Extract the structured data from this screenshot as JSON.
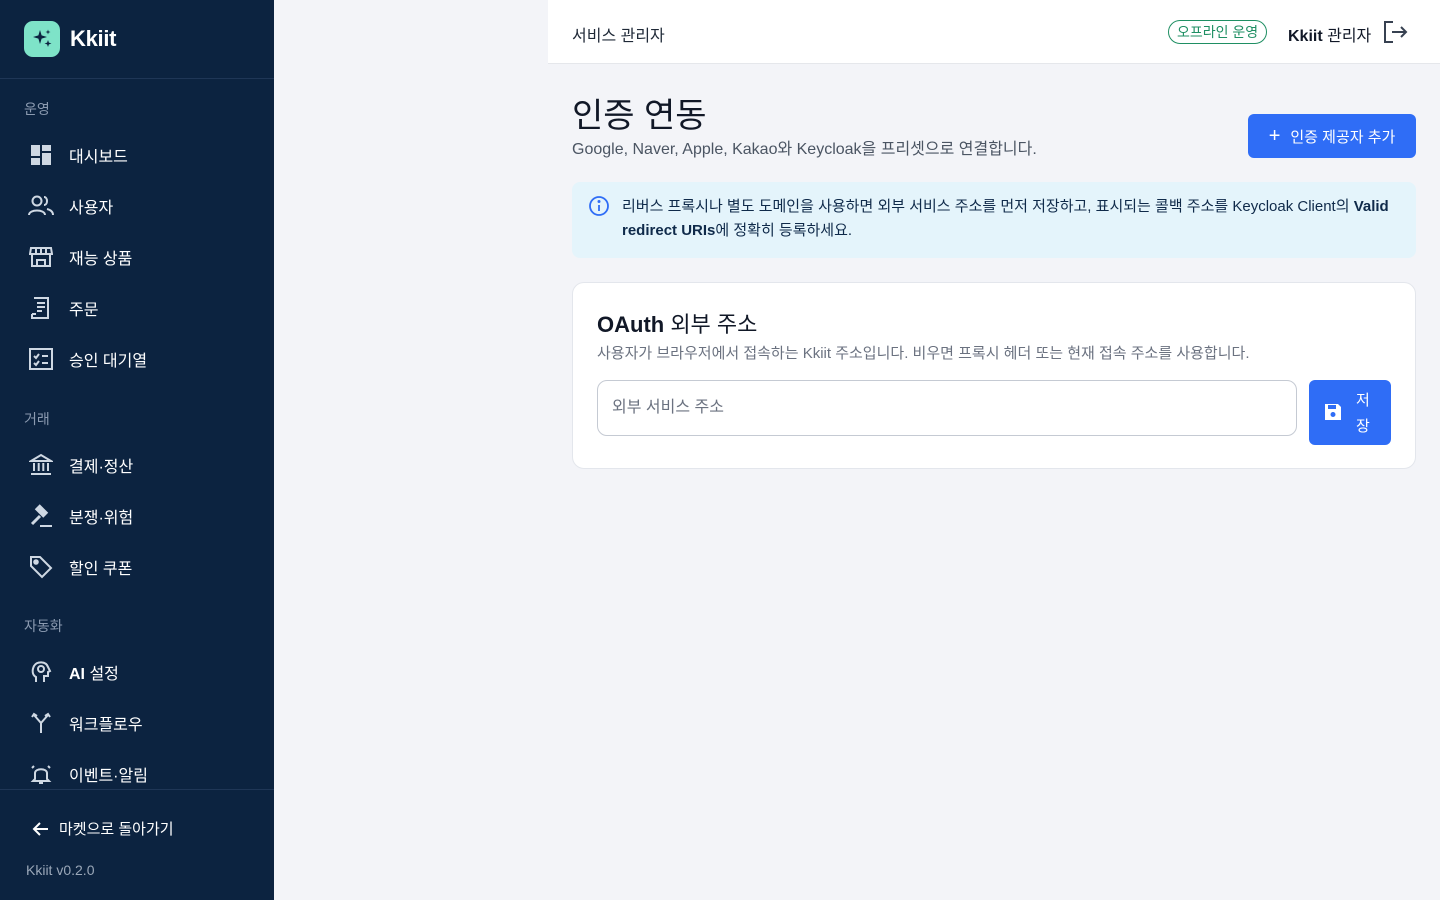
{
  "brand": {
    "name": "Kkiit"
  },
  "sidebar": {
    "sections": [
      {
        "label": "운영",
        "items": [
          {
            "label": "대시보드",
            "icon": "dashboard-icon"
          },
          {
            "label": "사용자",
            "icon": "users-icon"
          },
          {
            "label": "재능 상품",
            "icon": "store-icon"
          },
          {
            "label": "주문",
            "icon": "receipt-icon"
          },
          {
            "label": "승인 대기열",
            "icon": "checklist-icon"
          }
        ]
      },
      {
        "label": "거래",
        "items": [
          {
            "label": "결제·정산",
            "icon": "bank-icon"
          },
          {
            "label": "분쟁·위험",
            "icon": "gavel-icon"
          },
          {
            "label": "할인 쿠폰",
            "icon": "tag-icon"
          }
        ]
      },
      {
        "label": "자동화",
        "items": [
          {
            "label_bold": "AI",
            "label": " 설정",
            "icon": "ai-head-icon"
          },
          {
            "label": "워크플로우",
            "icon": "workflow-icon"
          },
          {
            "label": "이벤트·알림",
            "icon": "bell-icon"
          }
        ]
      }
    ],
    "back_link": "마켓으로 돌아가기",
    "version": "Kkiit v0.2.0"
  },
  "header": {
    "title": "서비스 관리자",
    "status_badge": "오프라인 운영",
    "user_brand": "Kkiit",
    "user_role": " 관리자"
  },
  "page": {
    "title": "인증 연동",
    "subtitle": "Google, Naver, Apple, Kakao와 Keycloak을 프리셋으로 연결합니다.",
    "add_button": "인증 제공자 추가"
  },
  "info": {
    "text_1": "리버스 프록시나 별도 도메인을 사용하면 외부 서비스 주소를 먼저 저장하고, 표시되는 콜백 주소를 Keycloak Client의 ",
    "text_bold": "Valid redirect URIs",
    "text_2": "에 정확히 등록하세요."
  },
  "card": {
    "title_bold": "OAuth",
    "title": " 외부 주소",
    "description": "사용자가 브라우저에서 접속하는 Kkiit 주소입니다. 비우면 프록시 헤더 또는 현재 접속 주소를 사용합니다.",
    "input_placeholder": "외부 서비스 주소",
    "input_value": "",
    "save_button": "저장"
  },
  "colors": {
    "sidebar_bg": "#0c2340",
    "accent": "#2f6df6",
    "badge_green": "#1f8f63",
    "logo_mint": "#7ee3c8",
    "info_bg": "#e4f4fb"
  }
}
